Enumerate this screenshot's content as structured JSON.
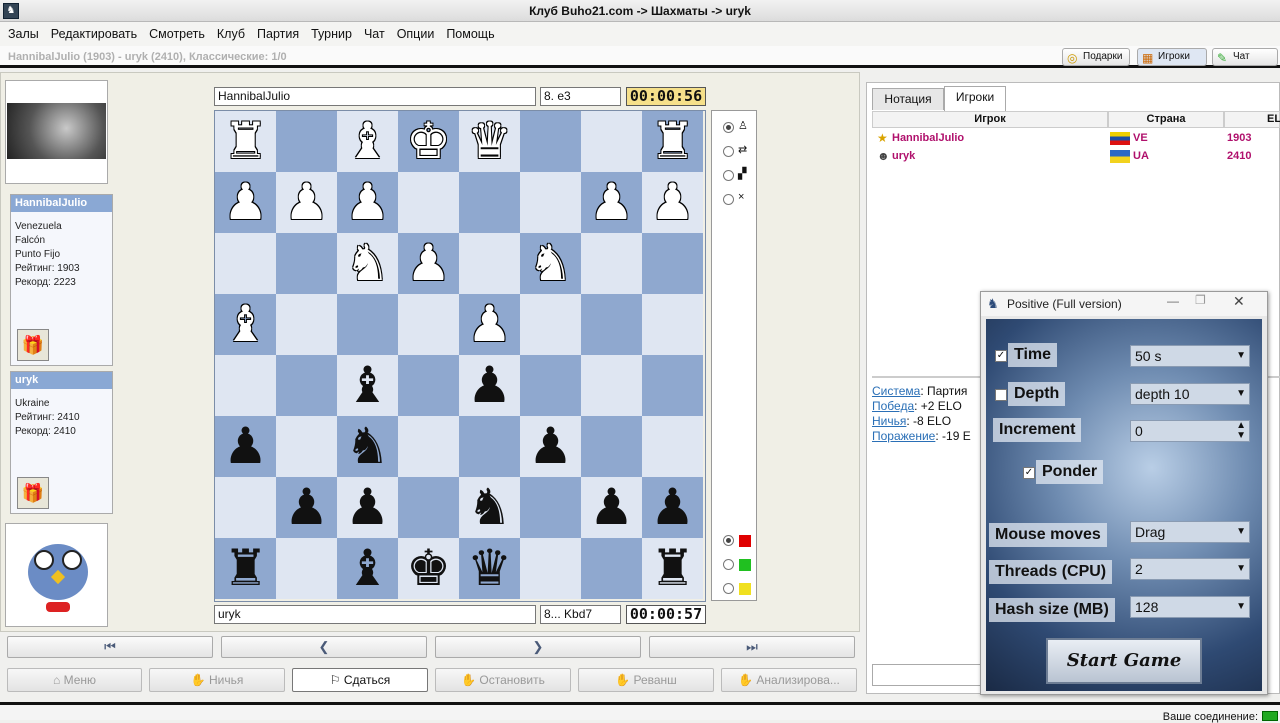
{
  "window": {
    "title": "Клуб Buho21.com -> Шахматы -> uryk"
  },
  "menu": [
    "Залы",
    "Редактировать",
    "Смотреть",
    "Клуб",
    "Партия",
    "Турнир",
    "Чат",
    "Опции",
    "Помощь"
  ],
  "game_info": "HannibalJulio (1903) - uryk (2410), Классические: 1/0",
  "top_buttons": {
    "gifts": "Подарки",
    "players": "Игроки",
    "chat": "Чат"
  },
  "players": {
    "top": {
      "name": "HannibalJulio",
      "country": "Venezuela",
      "region": "Falcón",
      "city": "Punto Fijo",
      "rating": "Рейтинг: 1903",
      "record": "Рекорд: 2223"
    },
    "bottom": {
      "name": "uryk",
      "country": "Ukraine",
      "rating": "Рейтинг: 2410",
      "record": "Рекорд: 2410"
    }
  },
  "board": {
    "top_player": "HannibalJulio",
    "top_move": "8. e3",
    "top_clock": "00:00:56",
    "bottom_player": "uryk",
    "bottom_move": "8... Kbd7",
    "bottom_clock": "00:00:57",
    "position": [
      [
        "R",
        "",
        "B",
        "K",
        "Q",
        "",
        "",
        "R"
      ],
      [
        "P",
        "P",
        "P",
        "",
        "",
        "",
        "P",
        "P"
      ],
      [
        "",
        "",
        "N",
        "P",
        "",
        "N",
        "",
        ""
      ],
      [
        "B",
        "",
        "",
        "",
        "P",
        "",
        "",
        ""
      ],
      [
        "",
        "",
        "b",
        "",
        "p",
        "",
        "",
        ""
      ],
      [
        "p",
        "",
        "n",
        "",
        "",
        "p",
        "",
        ""
      ],
      [
        "",
        "p",
        "p",
        "",
        "n",
        "",
        "p",
        "p"
      ],
      [
        "r",
        "",
        "b",
        "k",
        "q",
        "",
        "",
        "r"
      ]
    ]
  },
  "color_options": [
    "#e00000",
    "#20c020",
    "#f0e020"
  ],
  "nav": {
    "first": "⏮",
    "prev": "❮",
    "next": "❯",
    "last": "⏭"
  },
  "actions": {
    "menu": "Меню",
    "draw": "Ничья",
    "resign": "Сдаться",
    "stop": "Остановить",
    "rematch": "Реванш",
    "analyze": "Анализирова..."
  },
  "right": {
    "tabs": [
      "Нотация",
      "Игроки"
    ],
    "columns": [
      "Игрок",
      "Страна",
      "EL"
    ],
    "rows": [
      {
        "name": "HannibalJulio",
        "country": "VE",
        "elo": "1903"
      },
      {
        "name": "uryk",
        "country": "UA",
        "elo": "2410"
      }
    ],
    "elo_info": {
      "system_label": "Система",
      "system_value": ": Партия",
      "win_label": "Победа",
      "win_value": ": +2 ELO",
      "draw_label": "Ничья",
      "draw_value": ": -8 ELO",
      "loss_label": "Поражение",
      "loss_value": ": -19 E"
    }
  },
  "engine": {
    "title": "Positive (Full version)",
    "time_label": "Time",
    "time_value": "50 s",
    "depth_label": "Depth",
    "depth_value": "depth 10",
    "increment_label": "Increment",
    "increment_value": "0",
    "ponder_label": "Ponder",
    "mouse_label": "Mouse moves",
    "mouse_value": "Drag",
    "threads_label": "Threads (CPU)",
    "threads_value": "2",
    "hash_label": "Hash size (MB)",
    "hash_value": "128",
    "start": "Start Game"
  },
  "status": {
    "connection": "Ваше соединение:"
  }
}
